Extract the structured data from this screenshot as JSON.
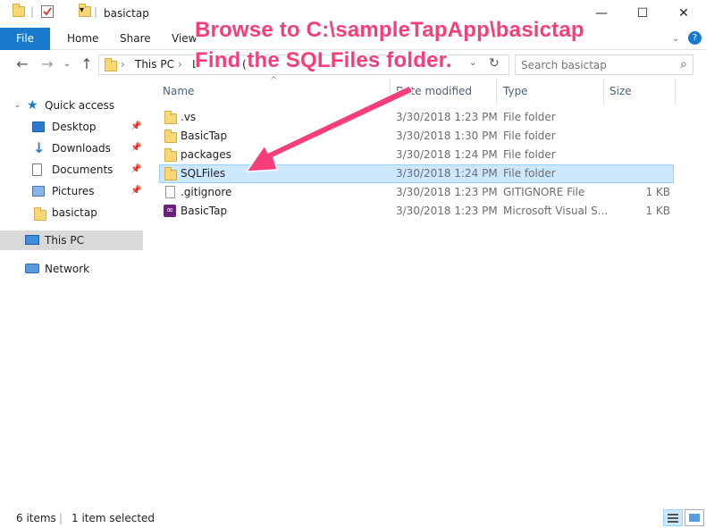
{
  "window": {
    "title": "basictap",
    "controls": {
      "minimize": "—",
      "maximize": "☐",
      "close": "✕"
    }
  },
  "ribbon": {
    "tabs": [
      "File",
      "Home",
      "Share",
      "View"
    ],
    "expand_icon": "chevron-down-icon",
    "help_icon": "help-icon"
  },
  "address": {
    "crumbs": [
      "This PC",
      "L",
      "("
    ],
    "search_placeholder": "Search basictap"
  },
  "navpane": {
    "quick_access": "Quick access",
    "pinned": [
      "Desktop",
      "Downloads",
      "Documents",
      "Pictures"
    ],
    "unpinned": [
      "basictap"
    ],
    "this_pc": "This PC",
    "network": "Network"
  },
  "columns": {
    "name": "Name",
    "date": "Date modified",
    "type": "Type",
    "size": "Size"
  },
  "files": [
    {
      "name": ".vs",
      "date": "3/30/2018 1:23 PM",
      "type": "File folder",
      "size": "",
      "icon": "folder-icon"
    },
    {
      "name": "BasicTap",
      "date": "3/30/2018 1:30 PM",
      "type": "File folder",
      "size": "",
      "icon": "folder-icon"
    },
    {
      "name": "packages",
      "date": "3/30/2018 1:24 PM",
      "type": "File folder",
      "size": "",
      "icon": "folder-icon"
    },
    {
      "name": "SQLFiles",
      "date": "3/30/2018 1:24 PM",
      "type": "File folder",
      "size": "",
      "icon": "folder-icon",
      "selected": true
    },
    {
      "name": ".gitignore",
      "date": "3/30/2018 1:23 PM",
      "type": "GITIGNORE File",
      "size": "1 KB",
      "icon": "file-icon"
    },
    {
      "name": "BasicTap",
      "date": "3/30/2018 1:23 PM",
      "type": "Microsoft Visual S...",
      "size": "1 KB",
      "icon": "visual-studio-icon"
    }
  ],
  "status": {
    "count": "6 items",
    "selection": "1 item selected"
  },
  "annotation": {
    "line1": "Browse to C:\\sampleTapApp\\basictap",
    "line2": "Find the SQLFiles folder.",
    "color": "#f53e7a"
  }
}
